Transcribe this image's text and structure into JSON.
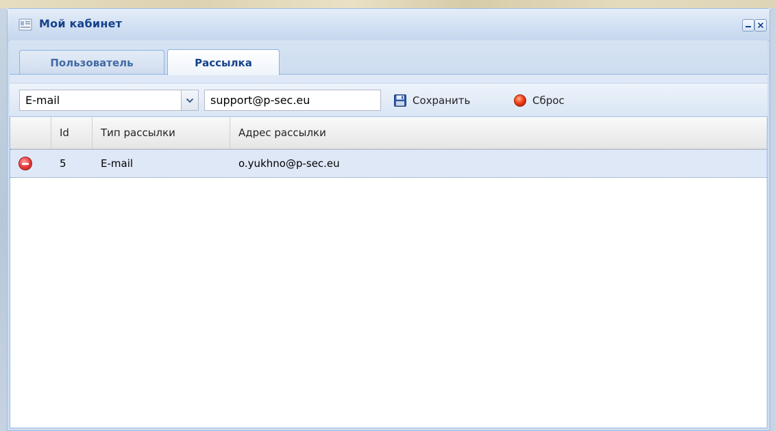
{
  "window": {
    "title": "Мой кабинет",
    "icon": "card-icon",
    "tools": [
      "minimize-icon",
      "close-icon"
    ]
  },
  "tabs": [
    {
      "label": "Пользователь",
      "active": false
    },
    {
      "label": "Рассылка",
      "active": true
    }
  ],
  "toolbar": {
    "type_select_value": "E-mail",
    "address_input_value": "support@p-sec.eu",
    "save_label": "Сохранить",
    "save_icon": "floppy-disk-icon",
    "reset_label": "Сброс",
    "reset_icon": "red-circle-icon"
  },
  "grid": {
    "columns": [
      "",
      "Id",
      "Тип рассылки",
      "Адрес рассылки"
    ],
    "rows": [
      {
        "id": "5",
        "type": "E-mail",
        "address": "o.yukhno@p-sec.eu",
        "action_icon": "delete-icon"
      }
    ]
  },
  "colors": {
    "title_text": "#15428b",
    "frame": "#99bbe8",
    "selected_row": "#dfe8f6",
    "delete": "#e4393b"
  }
}
